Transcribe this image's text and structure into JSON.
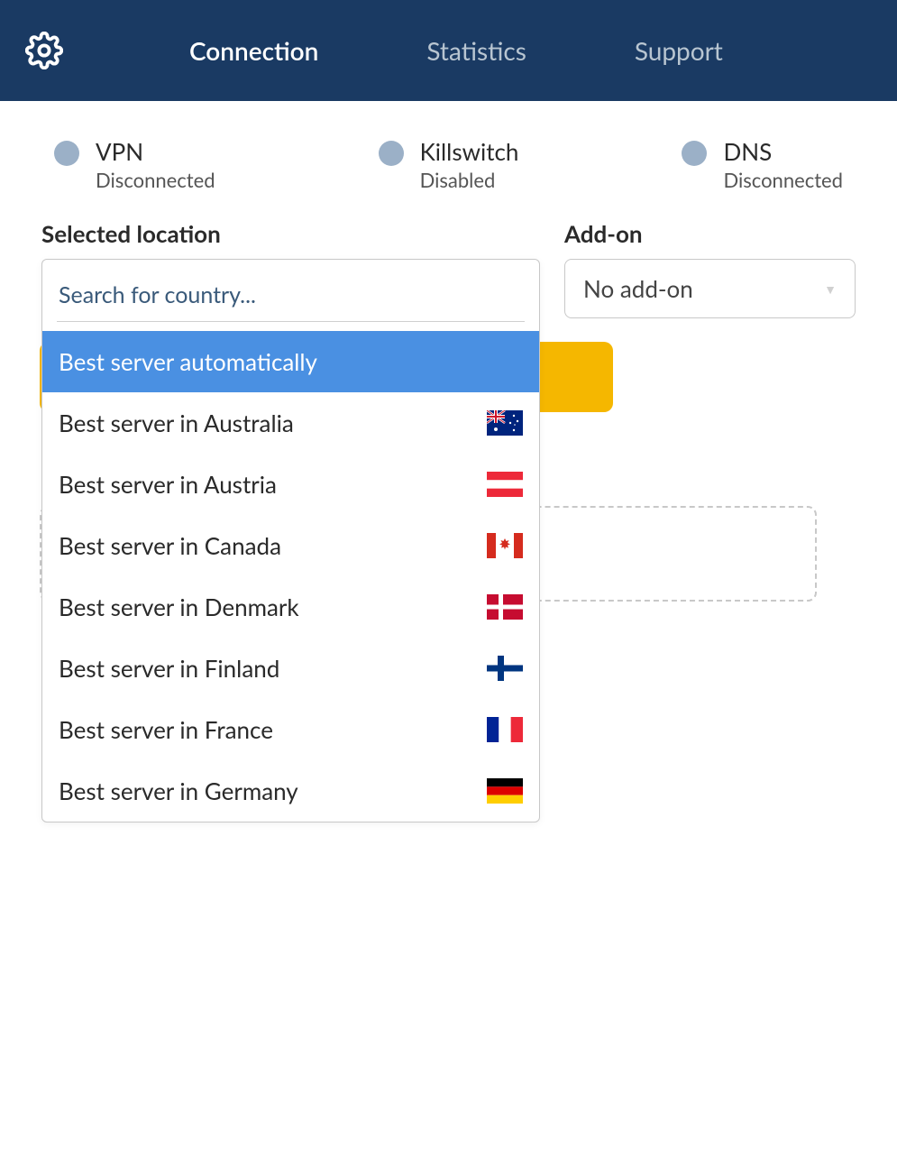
{
  "header": {
    "tabs": [
      {
        "label": "Connection",
        "active": true
      },
      {
        "label": "Statistics",
        "active": false
      },
      {
        "label": "Support",
        "active": false
      }
    ]
  },
  "status": {
    "vpn": {
      "title": "VPN",
      "sub": "Disconnected"
    },
    "killswitch": {
      "title": "Killswitch",
      "sub": "Disabled"
    },
    "dns": {
      "title": "DNS",
      "sub": "Disconnected"
    }
  },
  "location": {
    "label": "Selected location",
    "search_placeholder": "Search for country...",
    "options": [
      {
        "label": "Best server automatically",
        "flag": null,
        "selected": true
      },
      {
        "label": "Best server in Australia",
        "flag": "au",
        "selected": false
      },
      {
        "label": "Best server in Austria",
        "flag": "at",
        "selected": false
      },
      {
        "label": "Best server in Canada",
        "flag": "ca",
        "selected": false
      },
      {
        "label": "Best server in Denmark",
        "flag": "dk",
        "selected": false
      },
      {
        "label": "Best server in Finland",
        "flag": "fi",
        "selected": false
      },
      {
        "label": "Best server in France",
        "flag": "fr",
        "selected": false
      },
      {
        "label": "Best server in Germany",
        "flag": "de",
        "selected": false
      }
    ]
  },
  "addon": {
    "label": "Add-on",
    "selected": "No add-on"
  }
}
